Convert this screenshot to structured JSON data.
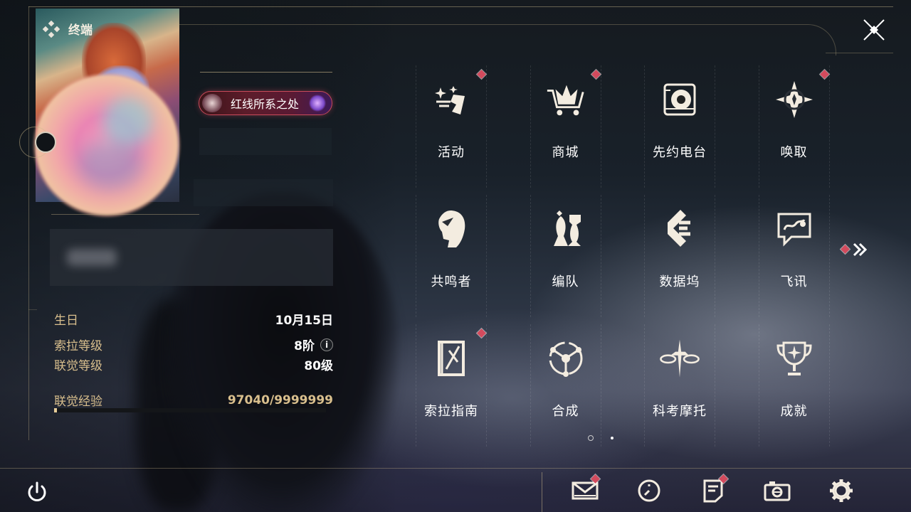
{
  "panel": {
    "title": "终端"
  },
  "profile": {
    "badge_text": "红线所系之处",
    "birthday": {
      "label": "生日",
      "value": "10月15日"
    },
    "sola_level": {
      "label": "索拉等级",
      "value": "8阶"
    },
    "union_level": {
      "label": "联觉等级",
      "value": "80级"
    },
    "union_exp": {
      "label": "联觉经验",
      "value": "97040/9999999",
      "progress": 0.0097
    }
  },
  "menu": {
    "items": [
      {
        "label": "活动",
        "icon": "activity-icon",
        "badge": true
      },
      {
        "label": "商城",
        "icon": "shop-basket-icon",
        "badge": true
      },
      {
        "label": "先约电台",
        "icon": "radio-speaker-icon",
        "badge": false
      },
      {
        "label": "唤取",
        "icon": "compass-star-icon",
        "badge": true
      },
      {
        "label": "共鸣者",
        "icon": "character-head-icon",
        "badge": false
      },
      {
        "label": "编队",
        "icon": "chess-pieces-icon",
        "badge": false
      },
      {
        "label": "数据坞",
        "icon": "data-bank-icon",
        "badge": false
      },
      {
        "label": "飞讯",
        "icon": "chat-message-icon",
        "badge": false
      },
      {
        "label": "索拉指南",
        "icon": "guide-book-icon",
        "badge": true
      },
      {
        "label": "合成",
        "icon": "synthesis-icon",
        "badge": false
      },
      {
        "label": "科考摩托",
        "icon": "motorbike-icon",
        "badge": false
      },
      {
        "label": "成就",
        "icon": "trophy-icon",
        "badge": false
      }
    ]
  },
  "pager": {
    "pages": 2,
    "current": 1
  },
  "bottom_bar": [
    {
      "name": "mail",
      "icon": "mail-icon",
      "badge": true
    },
    {
      "name": "history",
      "icon": "clock-icon",
      "badge": false
    },
    {
      "name": "notice",
      "icon": "notice-icon",
      "badge": true
    },
    {
      "name": "camera",
      "icon": "camera-icon",
      "badge": false
    },
    {
      "name": "settings",
      "icon": "gear-icon",
      "badge": false
    }
  ],
  "colors": {
    "accent": "#d9bf8d",
    "badge_red": "#d34a5d",
    "text": "#f2ece0"
  }
}
